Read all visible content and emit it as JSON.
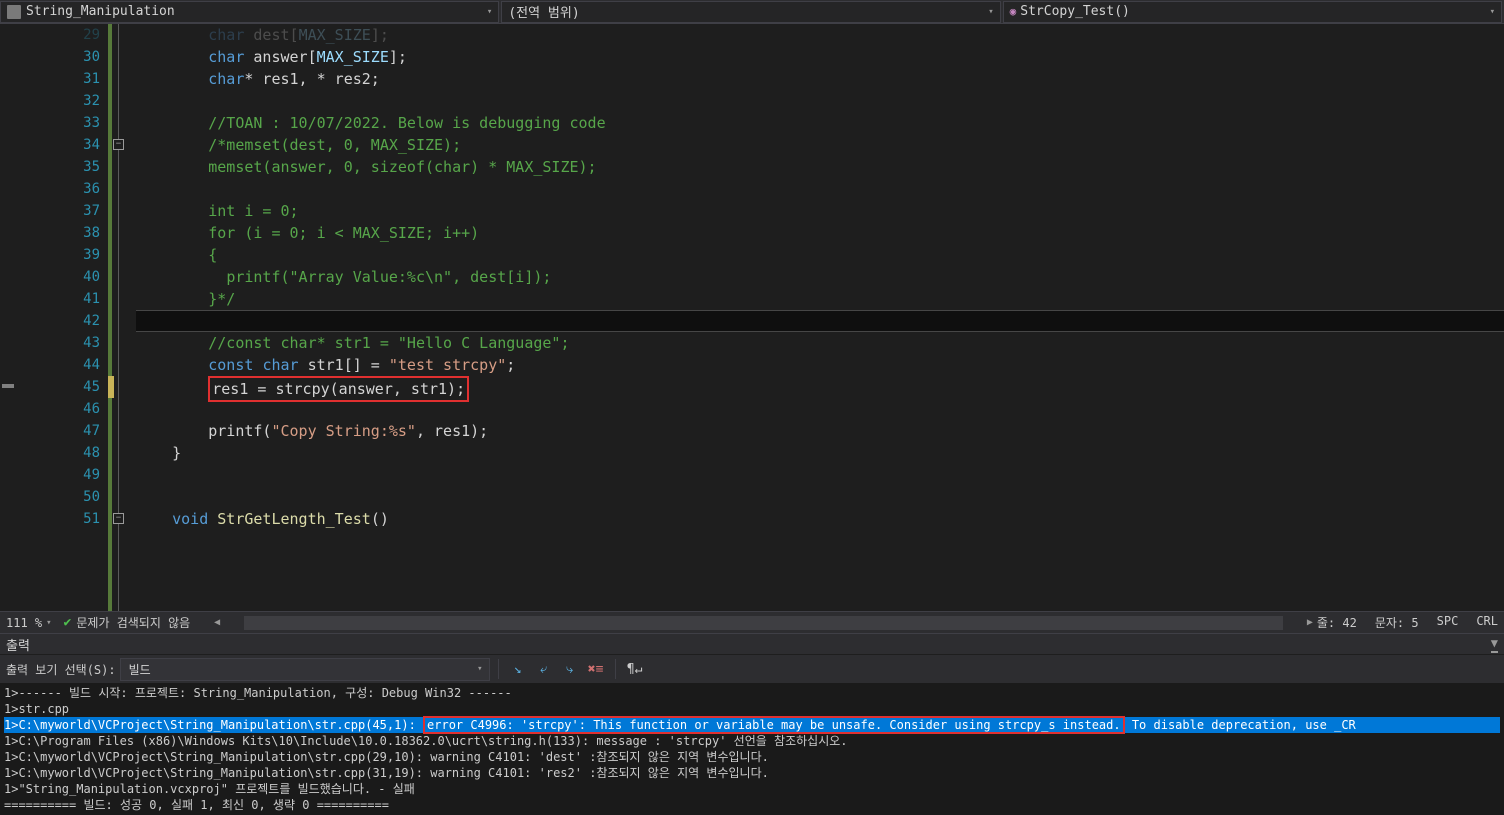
{
  "topbar": {
    "project": "String_Manipulation",
    "scope": "(전역 범위)",
    "function": "StrCopy_Test()"
  },
  "code": {
    "lines": [
      {
        "n": 29,
        "tokens": [
          {
            "t": "        ",
            "c": "text"
          },
          {
            "t": "char",
            "c": "kw"
          },
          {
            "t": " dest[",
            "c": "text"
          },
          {
            "t": "MAX_SIZE",
            "c": "var"
          },
          {
            "t": "];",
            "c": "text"
          }
        ],
        "faded": true
      },
      {
        "n": 30,
        "tokens": [
          {
            "t": "        ",
            "c": "text"
          },
          {
            "t": "char",
            "c": "kw"
          },
          {
            "t": " answer[",
            "c": "text"
          },
          {
            "t": "MAX_SIZE",
            "c": "var"
          },
          {
            "t": "];",
            "c": "text"
          }
        ]
      },
      {
        "n": 31,
        "tokens": [
          {
            "t": "        ",
            "c": "text"
          },
          {
            "t": "char",
            "c": "kw"
          },
          {
            "t": "* res1, * res2;",
            "c": "text"
          }
        ]
      },
      {
        "n": 32,
        "tokens": []
      },
      {
        "n": 33,
        "tokens": [
          {
            "t": "        ",
            "c": "text"
          },
          {
            "t": "//TOAN : 10/07/2022. Below is debugging code",
            "c": "comment"
          }
        ]
      },
      {
        "n": 34,
        "tokens": [
          {
            "t": "        ",
            "c": "text"
          },
          {
            "t": "/*memset(dest, 0, MAX_SIZE);",
            "c": "comment"
          }
        ],
        "fold": true
      },
      {
        "n": 35,
        "tokens": [
          {
            "t": "        ",
            "c": "text"
          },
          {
            "t": "memset(answer, 0, sizeof(char) * MAX_SIZE);",
            "c": "comment"
          }
        ]
      },
      {
        "n": 36,
        "tokens": []
      },
      {
        "n": 37,
        "tokens": [
          {
            "t": "        ",
            "c": "text"
          },
          {
            "t": "int i = 0;",
            "c": "comment"
          }
        ]
      },
      {
        "n": 38,
        "tokens": [
          {
            "t": "        ",
            "c": "text"
          },
          {
            "t": "for (i = 0; i < MAX_SIZE; i++)",
            "c": "comment"
          }
        ]
      },
      {
        "n": 39,
        "tokens": [
          {
            "t": "        ",
            "c": "text"
          },
          {
            "t": "{",
            "c": "comment"
          }
        ]
      },
      {
        "n": 40,
        "tokens": [
          {
            "t": "          ",
            "c": "text"
          },
          {
            "t": "printf(\"Array Value:%c\\n\", dest[i]);",
            "c": "comment"
          }
        ]
      },
      {
        "n": 41,
        "tokens": [
          {
            "t": "        ",
            "c": "text"
          },
          {
            "t": "}*/",
            "c": "comment"
          }
        ]
      },
      {
        "n": 42,
        "tokens": [],
        "current": true
      },
      {
        "n": 43,
        "tokens": [
          {
            "t": "        ",
            "c": "text"
          },
          {
            "t": "//const char* str1 = \"Hello C Language\";",
            "c": "comment"
          }
        ]
      },
      {
        "n": 44,
        "tokens": [
          {
            "t": "        ",
            "c": "text"
          },
          {
            "t": "const",
            "c": "kw"
          },
          {
            "t": " ",
            "c": "text"
          },
          {
            "t": "char",
            "c": "kw"
          },
          {
            "t": " str1[] = ",
            "c": "text"
          },
          {
            "t": "\"test strcpy\"",
            "c": "string"
          },
          {
            "t": ";",
            "c": "text"
          }
        ]
      },
      {
        "n": 45,
        "tokens": [
          {
            "t": "        ",
            "c": "text"
          }
        ],
        "highlighted": true,
        "highlight_content": [
          {
            "t": "res1 = strcpy(answer, str1);",
            "c": "text"
          }
        ],
        "yellow": true,
        "arrow": true
      },
      {
        "n": 46,
        "tokens": []
      },
      {
        "n": 47,
        "tokens": [
          {
            "t": "        ",
            "c": "text"
          },
          {
            "t": "printf(",
            "c": "text"
          },
          {
            "t": "\"Copy String:%s\"",
            "c": "string"
          },
          {
            "t": ", res1);",
            "c": "text"
          }
        ]
      },
      {
        "n": 48,
        "tokens": [
          {
            "t": "    }",
            "c": "text"
          }
        ]
      },
      {
        "n": 49,
        "tokens": []
      },
      {
        "n": 50,
        "tokens": []
      },
      {
        "n": 51,
        "tokens": [
          {
            "t": "    ",
            "c": "text"
          },
          {
            "t": "void",
            "c": "kw"
          },
          {
            "t": " ",
            "c": "text"
          },
          {
            "t": "StrGetLength_Test",
            "c": "func"
          },
          {
            "t": "()",
            "c": "text"
          }
        ],
        "foldstart": true
      }
    ]
  },
  "status": {
    "zoom": "111 %",
    "no_issues": "문제가 검색되지 않음",
    "line_label": "줄:",
    "line_val": "42",
    "char_label": "문자:",
    "char_val": "5",
    "spc": "SPC",
    "crlf": "CRL"
  },
  "output": {
    "title": "출력",
    "source_label": "출력 보기 선택(S):",
    "source_value": "빌드",
    "lines": [
      {
        "text": "1>------ 빌드 시작: 프로젝트: String_Manipulation, 구성: Debug Win32 ------"
      },
      {
        "text": "1>str.cpp"
      },
      {
        "selected": true,
        "prefix": "1>C:\\myworld\\VCProject\\String_Manipulation\\str.cpp(45,1): ",
        "boxed": "error C4996: 'strcpy': This function or variable may be unsafe. Consider using strcpy_s instead.",
        "suffix": " To disable deprecation, use _CR"
      },
      {
        "text": "1>C:\\Program Files (x86)\\Windows Kits\\10\\Include\\10.0.18362.0\\ucrt\\string.h(133): message : 'strcpy' 선언을 참조하십시오."
      },
      {
        "text": "1>C:\\myworld\\VCProject\\String_Manipulation\\str.cpp(29,10): warning C4101: 'dest' :참조되지 않은 지역 변수입니다."
      },
      {
        "text": "1>C:\\myworld\\VCProject\\String_Manipulation\\str.cpp(31,19): warning C4101: 'res2' :참조되지 않은 지역 변수입니다."
      },
      {
        "text": "1>\"String_Manipulation.vcxproj\" 프로젝트를 빌드했습니다. - 실패"
      },
      {
        "text": "========== 빌드: 성공 0, 실패 1, 최신 0, 생략 0 =========="
      }
    ]
  }
}
